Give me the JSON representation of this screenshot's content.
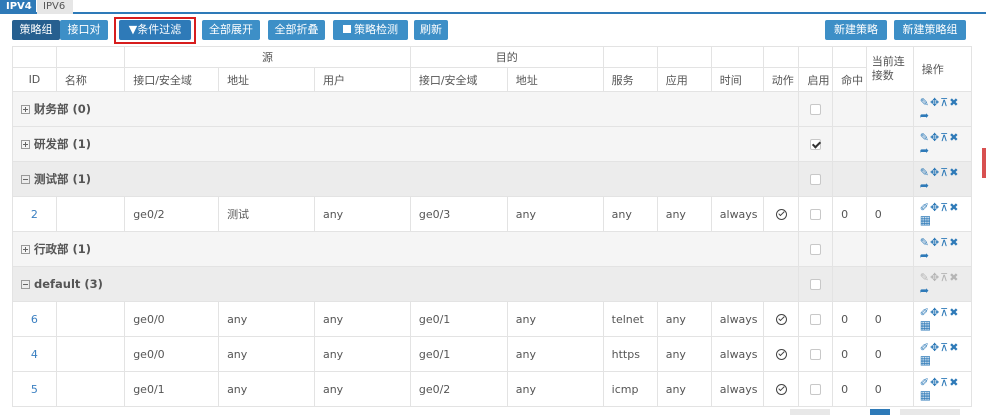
{
  "tabs": [
    "IPV4",
    "IPV6"
  ],
  "toolbar": {
    "policy_group": "策略组",
    "interface_pair": "接口对",
    "filter": "▼条件过滤",
    "expand_all": "全部展开",
    "collapse_all": "全部折叠",
    "policy_check": "策略检测",
    "refresh": "刷新",
    "new_policy": "新建策略",
    "new_policy_group": "新建策略组"
  },
  "headers": {
    "source": "源",
    "dest": "目的",
    "id": "ID",
    "name": "名称",
    "src_iface": "接口/安全域",
    "src_addr": "地址",
    "src_user": "用户",
    "dst_iface": "接口/安全域",
    "dst_addr": "地址",
    "service": "服务",
    "app": "应用",
    "time": "时间",
    "action": "动作",
    "enable": "启用",
    "hit": "命中",
    "conn": "当前连接数",
    "ops": "操作"
  },
  "groups": [
    {
      "label": "财务部 (0)",
      "expanded": false,
      "enabled": false
    },
    {
      "label": "研发部 (1)",
      "expanded": false,
      "enabled": true
    },
    {
      "label": "测试部 (1)",
      "expanded": true,
      "enabled": false
    },
    {
      "label": "行政部 (1)",
      "expanded": false,
      "enabled": false
    },
    {
      "label": "default (3)",
      "expanded": true,
      "enabled": false
    }
  ],
  "rules": [
    {
      "id": "2",
      "src_iface": "ge0/2",
      "src_addr": "测试",
      "src_user": "any",
      "dst_iface": "ge0/3",
      "dst_addr": "any",
      "service": "any",
      "app": "any",
      "time": "always",
      "hit": "0",
      "conn": "0"
    },
    {
      "id": "6",
      "src_iface": "ge0/0",
      "src_addr": "any",
      "src_user": "any",
      "dst_iface": "ge0/1",
      "dst_addr": "any",
      "service": "telnet",
      "app": "any",
      "time": "always",
      "hit": "0",
      "conn": "0"
    },
    {
      "id": "4",
      "src_iface": "ge0/0",
      "src_addr": "any",
      "src_user": "any",
      "dst_iface": "ge0/1",
      "dst_addr": "any",
      "service": "https",
      "app": "any",
      "time": "always",
      "hit": "0",
      "conn": "0"
    },
    {
      "id": "5",
      "src_iface": "ge0/1",
      "src_addr": "any",
      "src_user": "any",
      "dst_iface": "ge0/2",
      "dst_addr": "any",
      "service": "icmp",
      "app": "any",
      "time": "always",
      "hit": "0",
      "conn": "0"
    }
  ],
  "icons": {
    "edit": "✎",
    "move": "✥",
    "pin": "⊼",
    "delete": "✖",
    "share": "➦",
    "eraser": "✐",
    "table": "▦"
  }
}
